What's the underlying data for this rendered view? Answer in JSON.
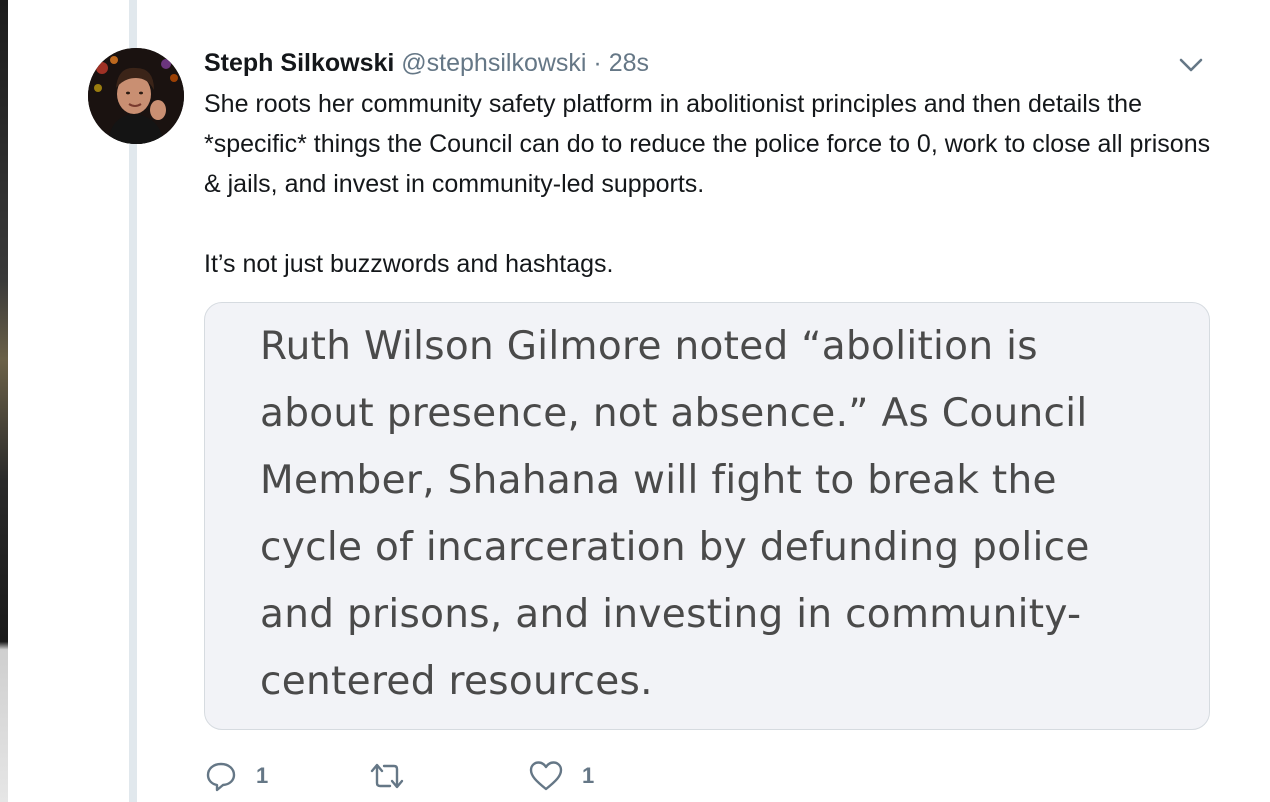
{
  "tweet": {
    "author_name": "Steph Silkowski",
    "handle": "@stephsilkowski",
    "separator": "·",
    "time": "28s",
    "paragraphs": [
      "She roots her community safety platform in abolitionist principles and then details the *specific* things the Council can do to reduce the police force to 0, work to close all prisons & jails, and invest in community-led supports.",
      "It’s not just buzzwords and hashtags."
    ],
    "media_text": "Ruth Wilson Gilmore noted “abolition is about presence, not absence.” As Council Member, Shahana will fight to break the cycle of incarceration by defunding police and prisons, and investing in community-centered resources."
  },
  "actions": {
    "reply_count": "1",
    "retweet_count": "",
    "like_count": "1"
  },
  "icons": {
    "reply": "reply-icon",
    "retweet": "retweet-icon",
    "like": "heart-icon",
    "menu": "chevron-down-icon"
  },
  "colors": {
    "text": "#14171a",
    "secondary": "#657786",
    "thread_line": "#e1e8ed",
    "media_bg": "#f2f3f7"
  }
}
